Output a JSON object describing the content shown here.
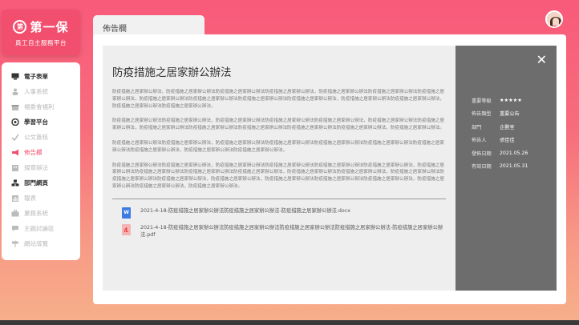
{
  "logo": {
    "mark": "第",
    "name": "第一保",
    "subtitle": "員工自主服務平台"
  },
  "sidebar": {
    "items": [
      {
        "label": "電子表單",
        "icon": "monitor-icon"
      },
      {
        "label": "人事系統",
        "icon": "person-icon"
      },
      {
        "label": "福委會福利",
        "icon": "gift-icon"
      },
      {
        "label": "學習平台",
        "icon": "book-icon"
      },
      {
        "label": "公文簽核",
        "icon": "checkmark-icon"
      },
      {
        "label": "佈告欄",
        "icon": "megaphone-icon"
      },
      {
        "label": "規章辦法",
        "icon": "building-icon"
      },
      {
        "label": "部門網頁",
        "icon": "network-icon"
      },
      {
        "label": "報表",
        "icon": "chart-icon"
      },
      {
        "label": "業務系統",
        "icon": "briefcase-icon"
      },
      {
        "label": "主題討論區",
        "icon": "chat-icon"
      },
      {
        "label": "網站導覽",
        "icon": "signpost-icon"
      }
    ]
  },
  "tab": {
    "label": "佈告欄"
  },
  "article": {
    "title": "防疫措施之居家辦公辦法",
    "paragraphs": [
      "防疫措施之居家辦公辦法，防疫措施之居家辦公辦法防疫措施之居家辦公辦法防疫措施之居家辦公辦法，防疫措施之居家辦公辦法防疫措施之居家辦公辦法防疫措施之居家辦公辦法，防疫措施之居家辦公辦法防疫措施之居家辦公辦法防疫措施之居家辦公辦法防疫措施之居家辦公辦法，防疫措施之居家辦公辦法防疫措施之居家辦公辦法，防疫措施之居家辦公辦法防疫措施之居家辦公辦法。",
      "防疫措施之居家辦公辦法防疫措施之居家辦公辦法，防疫措施之居家辦公辦法防疫措施之居家辦公辦法防疫措施之居家辦公辦法，防疫措施之居家辦公辦法防疫措施之居家辦公辦法，防疫措施之居家辦公辦法防疫措施之居家辦公辦法防疫措施之居家辦公辦法防疫措施之居家辦公辦法防疫措施之居家辦公辦法，防疫措施之居家辦公辦法。",
      "防疫措施之居家辦公辦法防疫措施之居家辦公辦法，防疫措施之居家辦公辦法防疫措施之居家辦公辦法防疫措施之居家辦公辦法防疫措施之居家辦公辦法防疫措施之居家辦公辦法防疫措施之居家辦公辦法，防疫措施之居家辦公辦法防疫措施之居家辦公辦法。",
      "防疫措施之居家辦公辦法防疫措施之居家辦公辦法，防疫措施之居家辦公辦法防疫措施之居家辦公辦法防疫措施之居家辦公辦法防疫措施之居家辦公辦法，防疫措施之居家辦公辦法防疫措施之居家辦公辦法防疫措施之居家辦公辦法防疫措施之居家辦公辦法，防疫措施之居家辦公辦法防疫措施之居家辦公辦法，防疫措施之居家辦公辦法防疫措施之居家辦公辦法防疫措施之居家辦公辦法，防疫措施之居家辦公辦法，防疫措施之居家辦公辦法防疫措施之居家辦公辦法防疫措施之居家辦公辦法，防疫措施之居家辦公辦法防疫措施之居家辦公辦法，防疫措施之居家辦公辦法。"
    ],
    "attachments": [
      {
        "name": "2021-4-18-防疫措施之居家辦公辦法防疫措施之居家辦公辦法-防疫措施之居家辦公辦法.docx",
        "type": "W",
        "icon": "word-file-icon"
      },
      {
        "name": "2021-4-18-防疫措施之居家辦公辦法防疫措施之居家辦公辦法防疫措施之居家辦公辦法防疫措施之居家辦公辦法-防疫措施之居家辦公辦法.pdf",
        "type": "",
        "icon": "pdf-file-icon"
      }
    ]
  },
  "meta": {
    "close_label": "✕",
    "rows": [
      {
        "key": "重要等級",
        "value": "★★★★★"
      },
      {
        "key": "佈告類型",
        "value": "重要公告"
      },
      {
        "key": "部門",
        "value": "企劃室"
      },
      {
        "key": "佈告人",
        "value": "張佳佳"
      },
      {
        "key": "發佈日期",
        "value": "2021.05.26"
      },
      {
        "key": "有效日期",
        "value": "2021.05.31"
      }
    ]
  }
}
